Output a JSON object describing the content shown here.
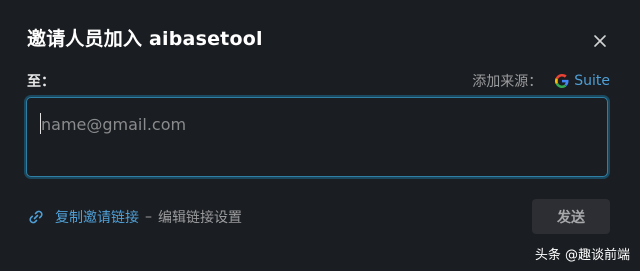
{
  "dialog": {
    "title": "邀请人员加入 aibasetool",
    "to_label": "至：",
    "add_from_label": "添加来源：",
    "gsuite_label": "Suite",
    "email_placeholder": "name@gmail.com",
    "copy_link": "复制邀请链接",
    "separator": "–",
    "edit_settings": "编辑链接设置",
    "send_button": "发送"
  },
  "watermark": "头条 @趣谈前端",
  "icons": [
    "close-icon",
    "google-g-icon",
    "link-icon"
  ],
  "colors": {
    "background": "#1a1d21",
    "accent_link": "#4f9fd6",
    "input_focus_border": "#2f7ea3",
    "send_button_bg": "#2c2e33"
  }
}
